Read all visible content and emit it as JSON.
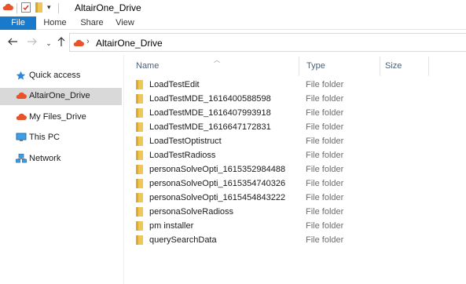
{
  "window": {
    "title": "AltairOne_Drive"
  },
  "ribbon": {
    "tabs": [
      {
        "label": "File"
      },
      {
        "label": "Home"
      },
      {
        "label": "Share"
      },
      {
        "label": "View"
      }
    ]
  },
  "address": {
    "path": "AltairOne_Drive"
  },
  "navpane": {
    "items": [
      {
        "label": "Quick access",
        "icon": "star-icon"
      },
      {
        "label": "AltairOne_Drive",
        "icon": "cloud-icon",
        "selected": true
      },
      {
        "label": "My Files_Drive",
        "icon": "cloud-icon"
      },
      {
        "label": "This PC",
        "icon": "computer-icon"
      },
      {
        "label": "Network",
        "icon": "network-icon"
      }
    ]
  },
  "columns": {
    "name": "Name",
    "type": "Type",
    "size": "Size"
  },
  "files": [
    {
      "name": "LoadTestEdit",
      "type": "File folder"
    },
    {
      "name": "LoadTestMDE_1616400588598",
      "type": "File folder"
    },
    {
      "name": "LoadTestMDE_1616407993918",
      "type": "File folder"
    },
    {
      "name": "LoadTestMDE_1616647172831",
      "type": "File folder"
    },
    {
      "name": "LoadTestOptistruct",
      "type": "File folder"
    },
    {
      "name": "LoadTestRadioss",
      "type": "File folder"
    },
    {
      "name": "personaSolveOpti_1615352984488",
      "type": "File folder"
    },
    {
      "name": "personaSolveOpti_1615354740326",
      "type": "File folder"
    },
    {
      "name": "personaSolveOpti_1615454843222",
      "type": "File folder"
    },
    {
      "name": "personaSolveRadioss",
      "type": "File folder"
    },
    {
      "name": "pm installer",
      "type": "File folder"
    },
    {
      "name": "querySearchData",
      "type": "File folder"
    }
  ],
  "colors": {
    "accent": "#1979ca",
    "folder": "#f0c654",
    "cloud": "#e8532a",
    "selection": "#d9d9d9"
  }
}
